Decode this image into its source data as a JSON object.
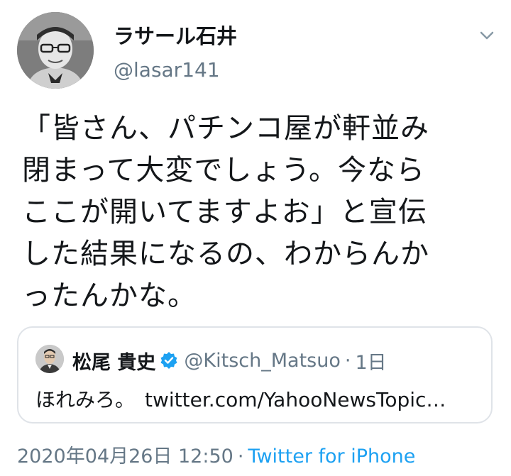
{
  "author": {
    "display_name": "ラサール石井",
    "handle": "@lasar141"
  },
  "tweet": {
    "text": "「皆さん、パチンコ屋が軒並み\n閉まって大変でしょう。今なら\nここが開いてますよお」と宣伝\nした結果になるの、わからんか\nったんかな。"
  },
  "quoted_tweet": {
    "display_name": "松尾 貴史",
    "handle": "@Kitsch_Matsuo",
    "separator": "·",
    "time": "1日",
    "text": "ほれみろ。",
    "link": "twitter.com/YahooNewsTopic…"
  },
  "meta": {
    "timestamp": "2020年04月26日 12:50",
    "separator": "·",
    "source": "Twitter for iPhone"
  },
  "icons": {
    "menu": "chevron-down-icon",
    "verified": "verified-badge-icon"
  },
  "colors": {
    "text": "#14171a",
    "secondary": "#657786",
    "accent": "#1da1f2",
    "border": "#dfe3e8"
  }
}
